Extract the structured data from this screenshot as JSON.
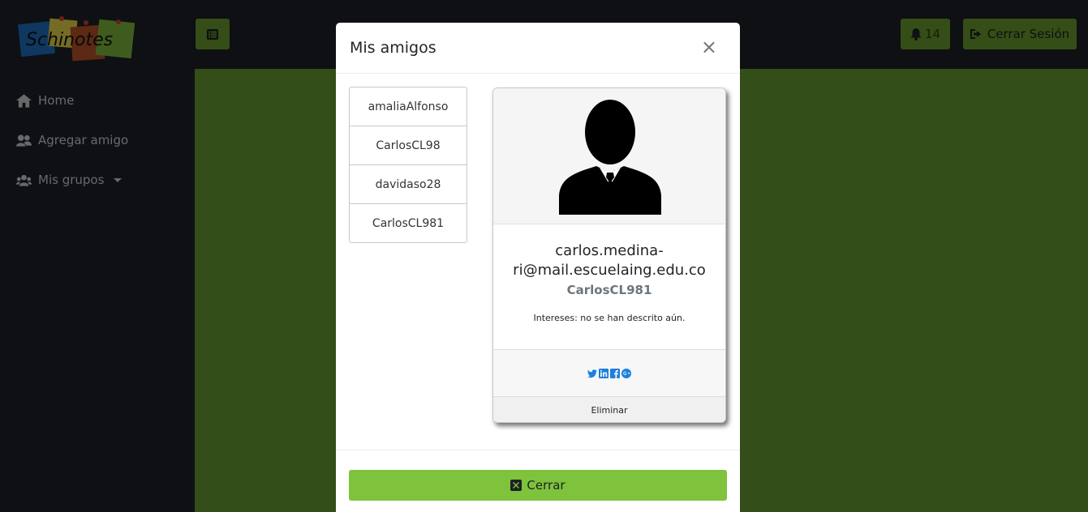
{
  "app": {
    "logo_text": "Schinotes",
    "nav": [
      {
        "label": "Home",
        "icon": "home-icon"
      },
      {
        "label": "Agregar amigo",
        "icon": "users-icon"
      },
      {
        "label": "Mis grupos",
        "icon": "group-icon"
      }
    ],
    "notifications_count": "14",
    "logout_label": "Cerrar Sesión",
    "colors": {
      "accent": "#6a9b2d",
      "content_bg": "#699c33",
      "sidebar_bg": "#1d2126",
      "close_button": "#7fc23c",
      "social_icons": "#1b7fde"
    }
  },
  "modal": {
    "title": "Mis amigos",
    "close_symbol": "×",
    "friends": [
      "amaliaAlfonso",
      "CarlosCL98",
      "davidaso28",
      "CarlosCL981"
    ],
    "card": {
      "email": "carlos.medina-ri@mail.escuelaing.edu.co",
      "email_line1": "carlos.medina-",
      "email_line2": "ri@mail.escuelaing.edu.co",
      "username": "CarlosCL981",
      "interests": "Intereses: no se han descrito aún.",
      "social": [
        "twitter-icon",
        "linkedin-icon",
        "facebook-icon",
        "google-plus-icon"
      ],
      "remove_label": "Eliminar"
    },
    "close_button_label": "Cerrar"
  }
}
